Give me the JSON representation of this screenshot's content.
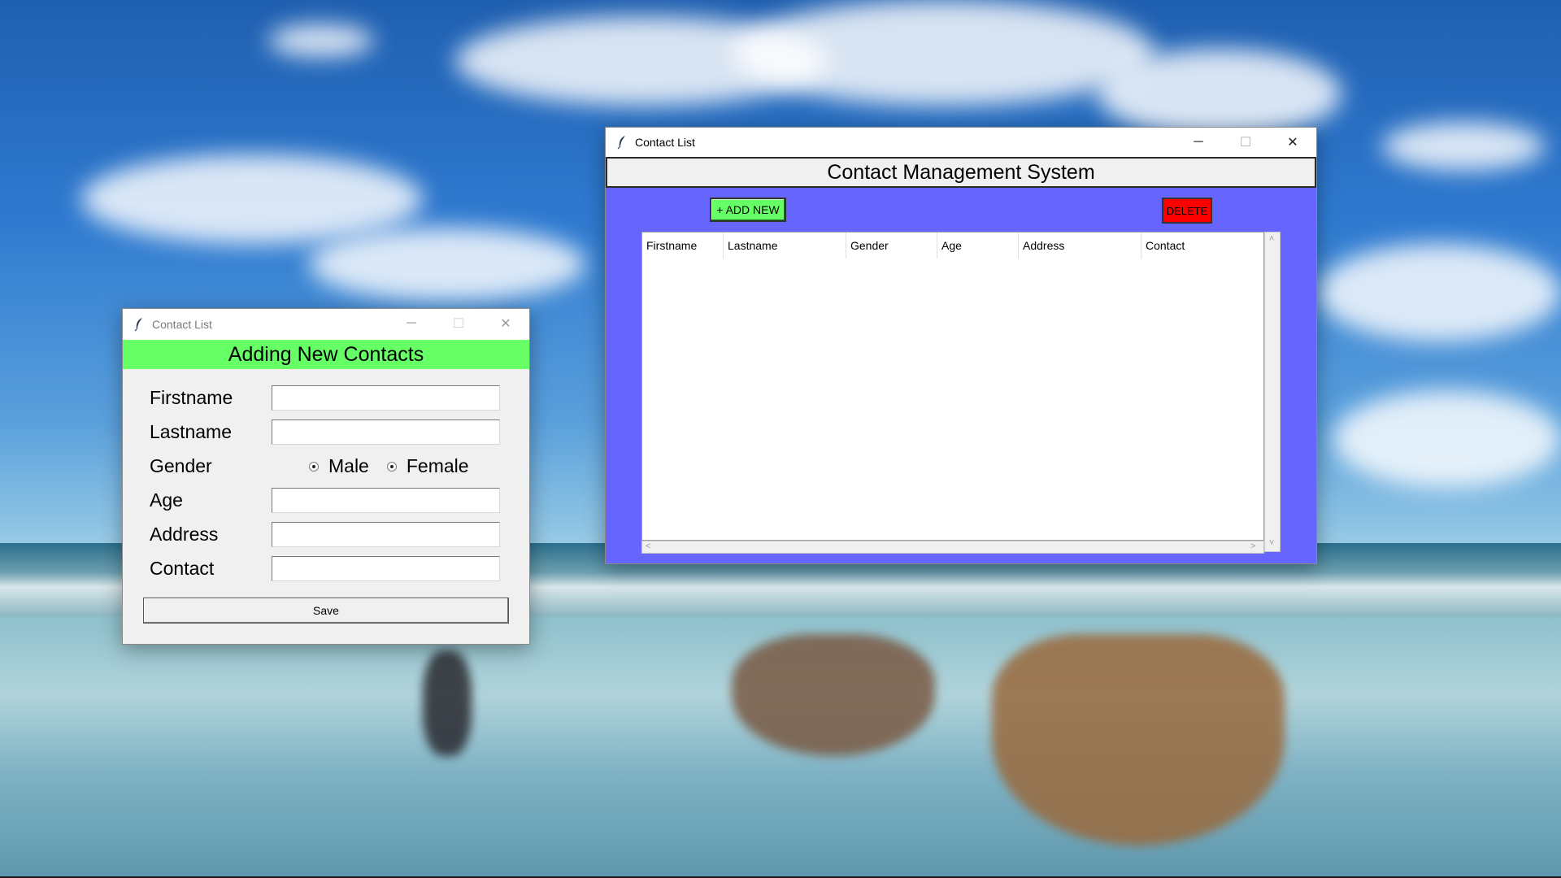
{
  "desktop": {
    "wallpaper": "beach-sky-wallpaper"
  },
  "main_window": {
    "title": "Contact List",
    "icon": "feather-icon",
    "controls": {
      "minimize": "─",
      "maximize": "☐",
      "close": "✕"
    },
    "header": "Contact Management System",
    "add_button": "+ ADD NEW",
    "delete_button": "DELETE",
    "table": {
      "columns": [
        "Firstname",
        "Lastname",
        "Gender",
        "Age",
        "Address",
        "Contact"
      ],
      "rows": []
    },
    "scroll_arrows": {
      "up": "˄",
      "down": "˅",
      "left": "<",
      "right": ">"
    },
    "colors": {
      "body": "#6666ff",
      "add": "#66ff66",
      "delete": "#ff0000"
    }
  },
  "form_window": {
    "title": "Contact List",
    "icon": "feather-icon",
    "controls": {
      "minimize": "─",
      "maximize": "☐",
      "close": "✕"
    },
    "header": "Adding New Contacts",
    "fields": {
      "firstname": {
        "label": "Firstname",
        "value": ""
      },
      "lastname": {
        "label": "Lastname",
        "value": ""
      },
      "gender": {
        "label": "Gender",
        "options": [
          "Male",
          "Female"
        ]
      },
      "age": {
        "label": "Age",
        "value": ""
      },
      "address": {
        "label": "Address",
        "value": ""
      },
      "contact": {
        "label": "Contact",
        "value": ""
      }
    },
    "save_button": "Save",
    "colors": {
      "header": "#66ff66"
    }
  }
}
